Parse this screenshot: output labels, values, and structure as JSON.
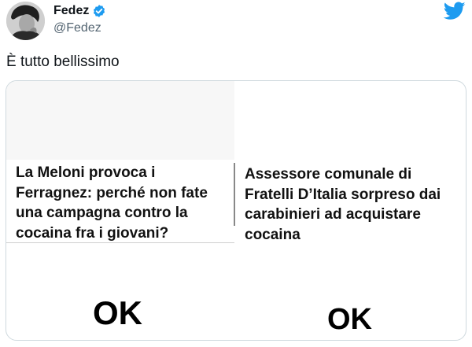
{
  "tweet": {
    "author": {
      "display_name": "Fedez",
      "handle": "@Fedez",
      "verified": true
    },
    "text": "È tutto bellissimo",
    "brand_color": "#1d9bf0",
    "icons": [
      "avatar",
      "verified-badge-icon",
      "twitter-bird-icon"
    ]
  },
  "meme": {
    "left": {
      "headline": "La Meloni provoca i\nFerragnez: perché non fate\nuna campagna contro la\ncocaina fra i giovani?",
      "reaction": "OK"
    },
    "right": {
      "headline": "Assessore comunale di\nFratelli D’Italia sorpreso dai\ncarabinieri ad acquistare\ncocaina",
      "reaction": "OK"
    }
  }
}
